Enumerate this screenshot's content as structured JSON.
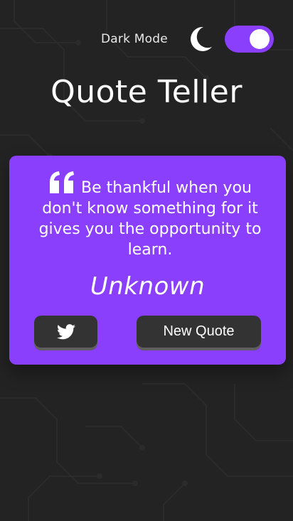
{
  "header": {
    "toggle_label": "Dark Mode",
    "toggle_state": "on",
    "toggle_icon": "moon-icon",
    "title": "Quote Teller"
  },
  "quote": {
    "icon": "quote-left-icon",
    "text": "Be thankful when you don't know something for it gives you the opportunity to learn.",
    "author": "Unknown"
  },
  "actions": {
    "twitter_icon": "twitter-icon",
    "new_quote_label": "New Quote"
  },
  "colors": {
    "background": "#232323",
    "accent": "#8a3ffc",
    "button": "#333333",
    "text": "#ffffff"
  }
}
